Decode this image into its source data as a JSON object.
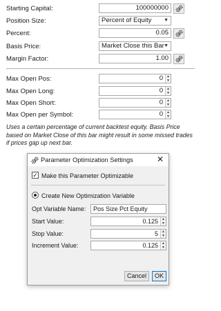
{
  "settings": {
    "starting_capital": {
      "label": "Starting Capital:",
      "value": "100000000"
    },
    "position_size": {
      "label": "Position Size:",
      "value": "Percent of Equity"
    },
    "percent": {
      "label": "Percent:",
      "value": "0.05"
    },
    "basis_price": {
      "label": "Basis Price:",
      "value": "Market Close this Bar"
    },
    "margin_factor": {
      "label": "Margin Factor:",
      "value": "1.00"
    },
    "max_open_pos": {
      "label": "Max Open Pos:",
      "value": "0"
    },
    "max_open_long": {
      "label": "Max Open Long:",
      "value": "0"
    },
    "max_open_short": {
      "label": "Max Open Short:",
      "value": "0"
    },
    "max_open_per_symbol": {
      "label": "Max Open per Symbol:",
      "value": "0"
    },
    "description": "Uses a certain percentage of current backtest equity. Basis Price based on Market Close of this bar might result in some missed trades if prices gap up next bar."
  },
  "dialog": {
    "title": "Parameter Optimization Settings",
    "make_optimizable": {
      "label": "Make this Parameter Optimizable",
      "checked": true
    },
    "create_variable": {
      "label": "Create New Optimization Variable",
      "selected": true
    },
    "opt_variable_name": {
      "label": "Opt Variable Name:",
      "value": "Pos Size Pct Equity"
    },
    "start_value": {
      "label": "Start Value:",
      "value": "0.125"
    },
    "stop_value": {
      "label": "Stop Value:",
      "value": "5"
    },
    "increment_value": {
      "label": "Increment Value:",
      "value": "0.125"
    },
    "cancel_label": "Cancel",
    "ok_label": "OK"
  },
  "icons": {
    "gear": "gear-icon",
    "dialog": "gears-icon",
    "close": "close-icon",
    "dropdown": "chevron-down-icon"
  },
  "colors": {
    "dialog_bg": "#f0f0f0",
    "ok_border": "#0078d7"
  }
}
